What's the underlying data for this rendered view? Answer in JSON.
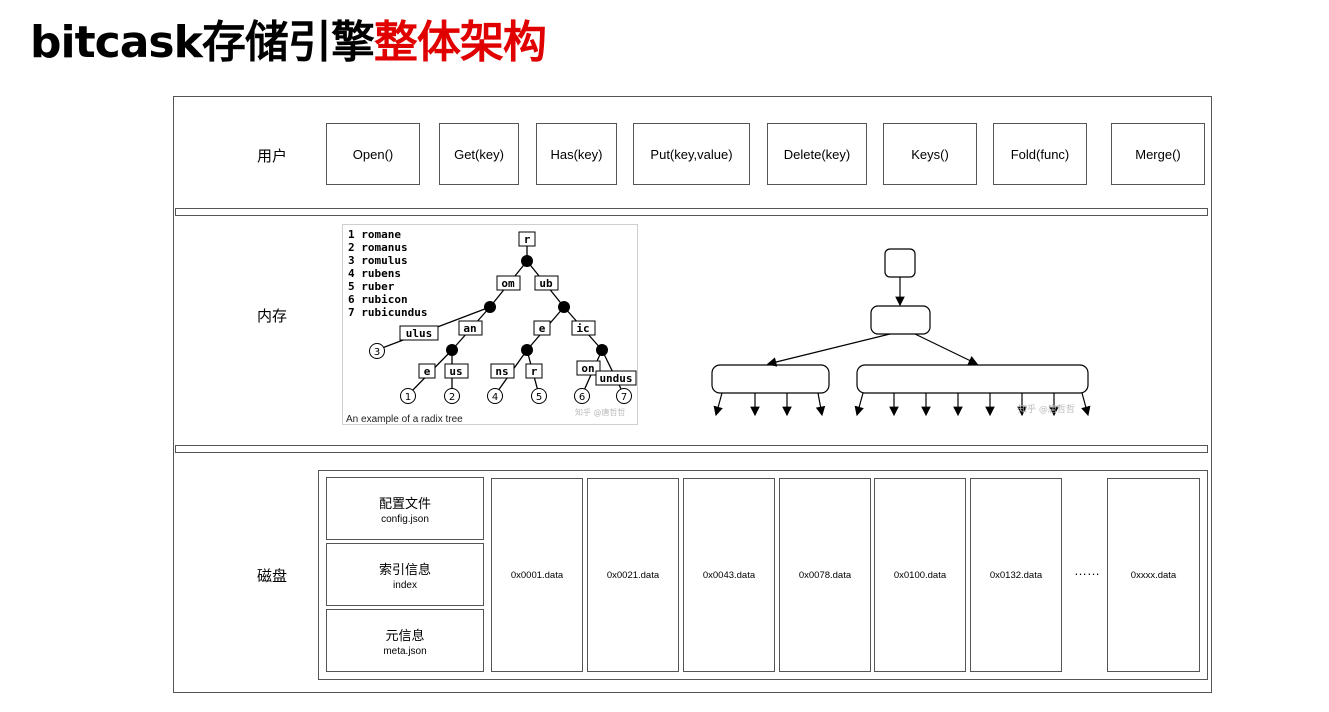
{
  "title": {
    "black": "bitcask存储引擎",
    "red": "整体架构"
  },
  "layers": {
    "user": "用户",
    "memory": "内存",
    "disk": "磁盘"
  },
  "user_ops": [
    "Open()",
    "Get(key)",
    "Has(key)",
    "Put(key,value)",
    "Delete(key)",
    "Keys()",
    "Fold(func)",
    "Merge()"
  ],
  "radix": {
    "words": [
      "1 romane",
      "2 romanus",
      "3 romulus",
      "4 rubens",
      "5 ruber",
      "6 rubicon",
      "7 rubicundus"
    ],
    "edges": [
      "r",
      "om",
      "ub",
      "ulus",
      "an",
      "e",
      "ic",
      "e",
      "us",
      "ns",
      "r",
      "on",
      "undus"
    ],
    "leaves": [
      "3",
      "1",
      "2",
      "4",
      "5",
      "6",
      "7"
    ],
    "caption": "An example of a radix tree",
    "watermark": "知乎 @唐哲哲"
  },
  "btree_watermark": "知乎 @唐哲哲",
  "disk": {
    "meta_files": [
      {
        "cn": "配置文件",
        "en": "config.json"
      },
      {
        "cn": "索引信息",
        "en": "index"
      },
      {
        "cn": "元信息",
        "en": "meta.json"
      }
    ],
    "data_files": [
      "0x0001.data",
      "0x0021.data",
      "0x0043.data",
      "0x0078.data",
      "0x0100.data",
      "0x0132.data"
    ],
    "ellipsis": "……",
    "last_file": "0xxxx.data"
  }
}
